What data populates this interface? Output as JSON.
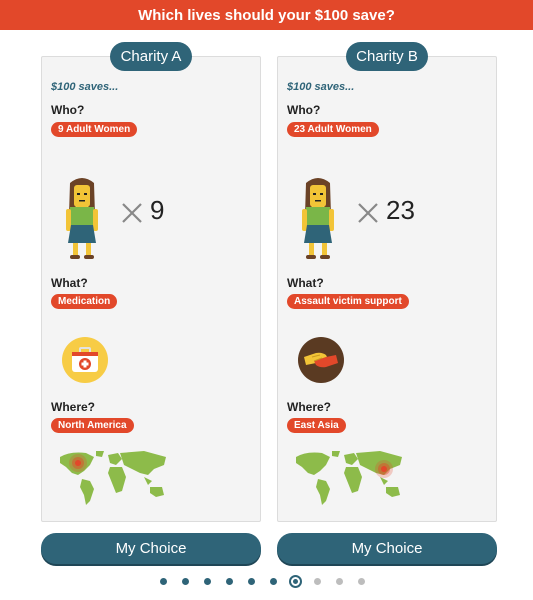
{
  "header": {
    "title": "Which lives should your $100 save?"
  },
  "charities": [
    {
      "name": "Charity A",
      "saves_label": "$100 saves...",
      "who_label": "Who?",
      "who_tag": "9 Adult Women",
      "multiplier_symbol": "✕",
      "count": "9",
      "what_label": "What?",
      "what_tag": "Medication",
      "what_icon": "first-aid-kit-icon",
      "where_label": "Where?",
      "where_tag": "North America",
      "button_label": "My Choice"
    },
    {
      "name": "Charity B",
      "saves_label": "$100 saves...",
      "who_label": "Who?",
      "who_tag": "23 Adult Women",
      "multiplier_symbol": "✕",
      "count": "23",
      "what_label": "What?",
      "what_tag": "Assault victim support",
      "what_icon": "helping-hands-icon",
      "where_label": "Where?",
      "where_tag": "East Asia",
      "button_label": "My Choice"
    }
  ],
  "pagination": {
    "total": 10,
    "current": 7
  },
  "colors": {
    "accent": "#e2482a",
    "primary": "#2f6478",
    "card_bg": "#f4f4f4",
    "map_green": "#8dbb4a"
  }
}
